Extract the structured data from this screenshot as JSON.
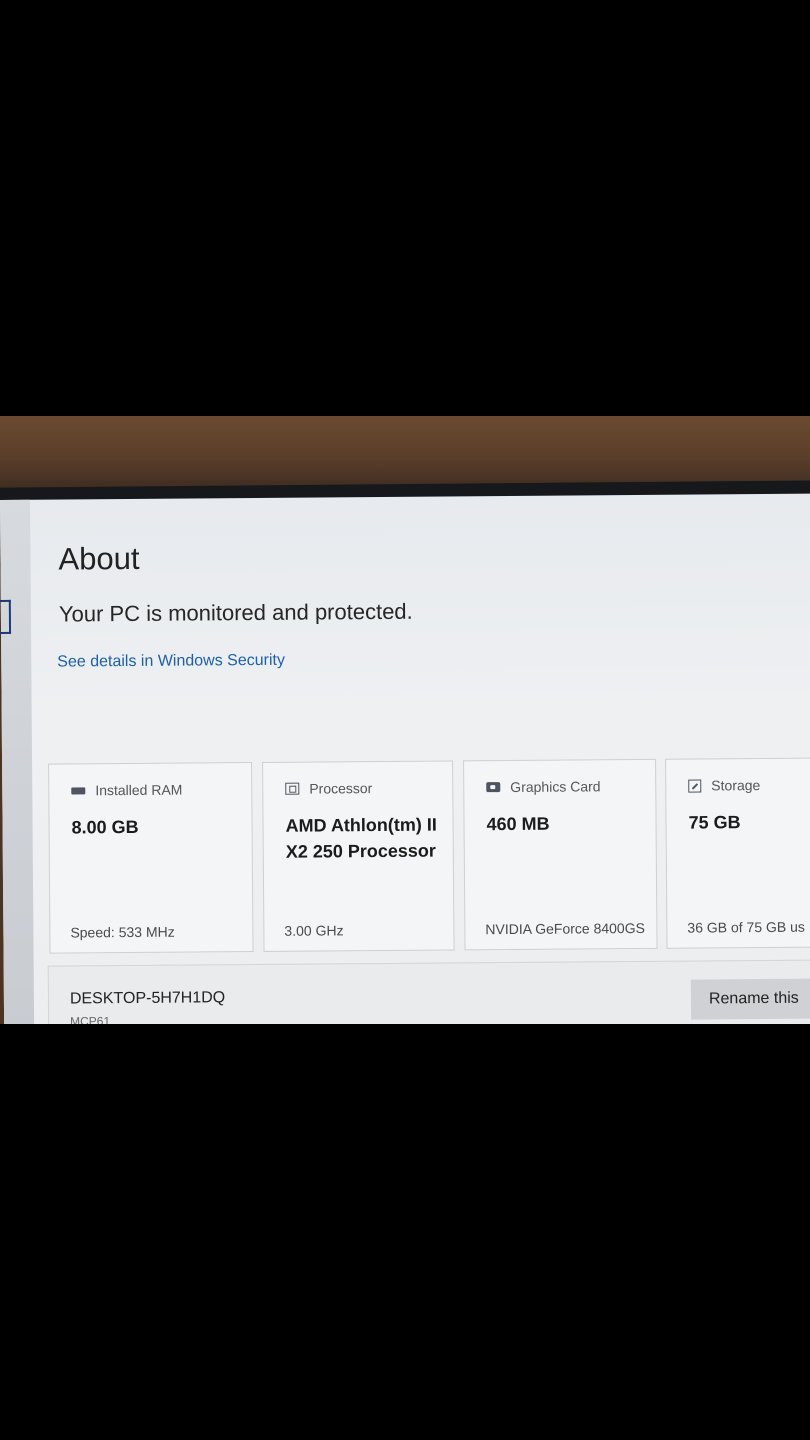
{
  "about": {
    "title": "About",
    "status": "Your PC is monitored and protected.",
    "security_link": "See details in Windows Security"
  },
  "specs": [
    {
      "icon": "ram-icon",
      "label": "Installed RAM",
      "value": "8.00 GB",
      "detail": "Speed: 533 MHz"
    },
    {
      "icon": "processor-icon",
      "label": "Processor",
      "value": "AMD Athlon(tm) II X2 250 Processor",
      "detail": "3.00 GHz"
    },
    {
      "icon": "graphics-card-icon",
      "label": "Graphics Card",
      "value": "460 MB",
      "detail": "NVIDIA GeForce 8400GS"
    },
    {
      "icon": "storage-icon",
      "label": "Storage",
      "value": "75 GB",
      "detail": "36 GB of 75 GB us"
    }
  ],
  "device": {
    "name": "DESKTOP-5H7H1DQ",
    "model": "MCP61",
    "rename_label": "Rename this"
  },
  "colors": {
    "link": "#1c5fae",
    "screen_bg": "#eceef0"
  }
}
